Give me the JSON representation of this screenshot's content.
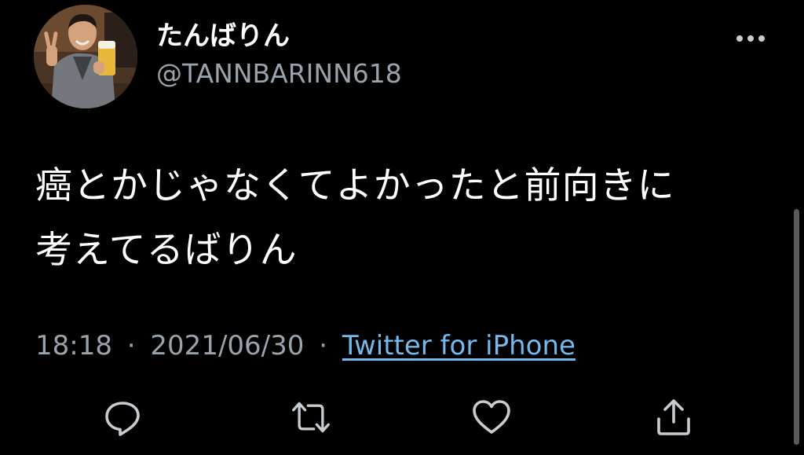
{
  "user": {
    "display_name": "たんばりん",
    "handle": "@TANNBARINN618"
  },
  "tweet": {
    "text_lines": [
      "癌とかじゃなくてよかったと前向きに",
      "考えてるばりん"
    ],
    "time": "18:18",
    "date": "2021/06/30",
    "separator": "·",
    "source": "Twitter for iPhone"
  },
  "actions": [
    {
      "icon": "reply-icon"
    },
    {
      "icon": "retweet-icon"
    },
    {
      "icon": "like-icon"
    },
    {
      "icon": "share-icon"
    }
  ],
  "colors": {
    "background": "#000000",
    "text": "#ffffff",
    "secondary": "#9aa3ab",
    "link": "#74b8ec",
    "icon": "#c7ccd1"
  }
}
